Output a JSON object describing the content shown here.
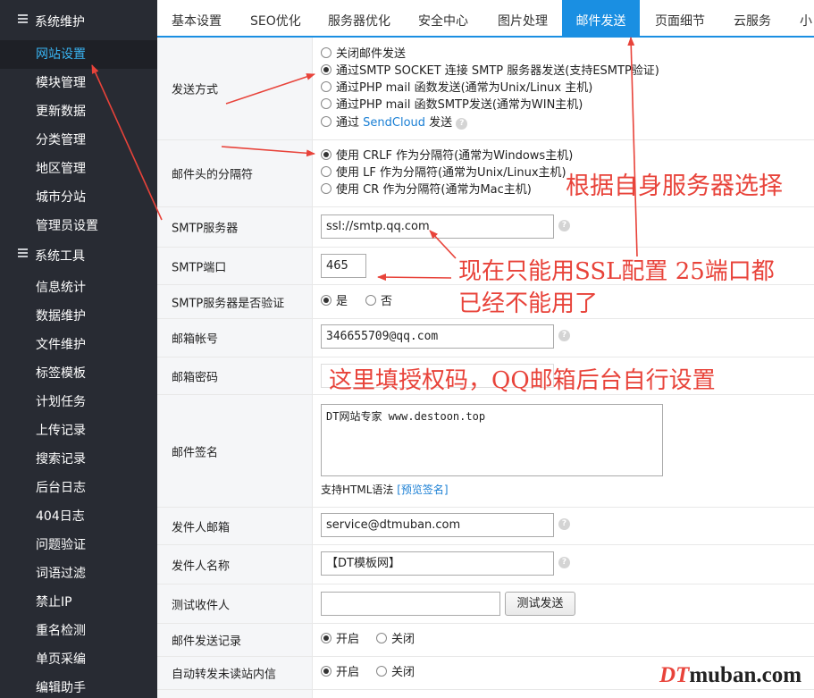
{
  "sidebar": {
    "group1": "系统维护",
    "group1_items": [
      "网站设置",
      "模块管理",
      "更新数据",
      "分类管理",
      "地区管理",
      "城市分站",
      "管理员设置"
    ],
    "group2": "系统工具",
    "group2_items": [
      "信息统计",
      "数据维护",
      "文件维护",
      "标签模板",
      "计划任务",
      "上传记录",
      "搜索记录",
      "后台日志",
      "404日志",
      "问题验证",
      "词语过滤",
      "禁止IP",
      "重名检测",
      "单页采编",
      "编辑助手"
    ]
  },
  "tabs": [
    "基本设置",
    "SEO优化",
    "服务器优化",
    "安全中心",
    "图片处理",
    "邮件发送",
    "页面细节",
    "云服务",
    "小"
  ],
  "form": {
    "send_method": {
      "label": "发送方式",
      "options": [
        {
          "text": "关闭邮件发送",
          "checked": false
        },
        {
          "text": "通过SMTP SOCKET 连接 SMTP 服务器发送(支持ESMTP验证)",
          "checked": true
        },
        {
          "text": "通过PHP mail 函数发送(通常为Unix/Linux 主机)",
          "checked": false
        },
        {
          "text": "通过PHP mail 函数SMTP发送(通常为WIN主机)",
          "checked": false
        }
      ],
      "sendcloud_prefix": "通过",
      "sendcloud_link": "SendCloud",
      "sendcloud_suffix": "发送"
    },
    "header_sep": {
      "label": "邮件头的分隔符",
      "options": [
        {
          "text": "使用 CRLF 作为分隔符(通常为Windows主机)",
          "checked": true
        },
        {
          "text": "使用 LF 作为分隔符(通常为Unix/Linux主机)",
          "checked": false
        },
        {
          "text": "使用 CR 作为分隔符(通常为Mac主机)",
          "checked": false
        }
      ]
    },
    "smtp_server": {
      "label": "SMTP服务器",
      "value": "ssl://smtp.qq.com"
    },
    "smtp_port": {
      "label": "SMTP端口",
      "value": "465"
    },
    "smtp_auth": {
      "label": "SMTP服务器是否验证",
      "yes": "是",
      "no": "否"
    },
    "account": {
      "label": "邮箱帐号",
      "value": "346655709@qq.com"
    },
    "password": {
      "label": "邮箱密码"
    },
    "signature": {
      "label": "邮件签名",
      "value": "DT网站专家 www.destoon.top",
      "note": "支持HTML语法",
      "preview": "[预览签名]"
    },
    "from_email": {
      "label": "发件人邮箱",
      "value": "service@dtmuban.com"
    },
    "from_name": {
      "label": "发件人名称",
      "value": "【DT模板网】"
    },
    "test_to": {
      "label": "测试收件人",
      "button": "测试发送"
    },
    "send_log": {
      "label": "邮件发送记录",
      "on": "开启",
      "off": "关闭"
    },
    "auto_forward": {
      "label": "自动转发未读站内信",
      "on": "开启",
      "off": "关闭"
    }
  },
  "annotations": {
    "server_choice": "根据自身服务器选择",
    "ssl_note_line1": "现在只能用SSL配置 25端口都",
    "ssl_note_line2": "已经不能用了",
    "auth_code": "这里填授权码，QQ邮箱后台自行设置"
  },
  "watermark": {
    "dt": "DT",
    "rest": "muban.com"
  },
  "help_glyph": "?",
  "colors": {
    "accent": "#1a8fe2",
    "annotation": "#e8433a",
    "sidebar_bg": "#282b33",
    "sidebar_active_text": "#39b4f2"
  }
}
